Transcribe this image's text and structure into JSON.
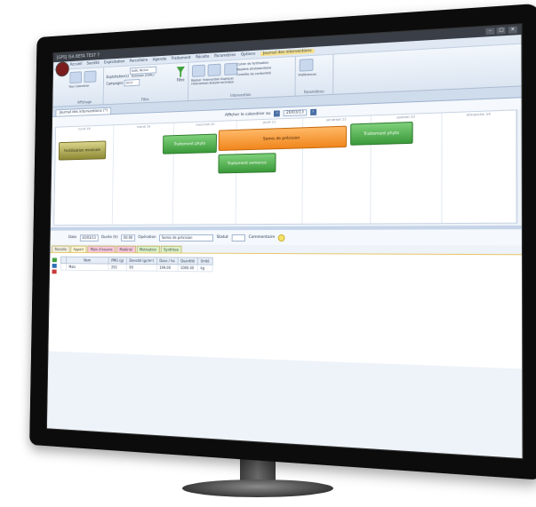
{
  "window": {
    "title": "[GPS] ISA BETA TEST 7",
    "controls": [
      "–",
      "□",
      "×"
    ]
  },
  "menu": {
    "items": [
      "Accueil",
      "Société",
      "Exploitation",
      "Parcellaire",
      "Agenda",
      "Traitement",
      "Récolte",
      "Paramètres",
      "Options"
    ],
    "active": "Journal des interventions"
  },
  "ribbon": {
    "groups": [
      {
        "label": "Affichage",
        "buttons": [
          "Tous",
          "Calendrier"
        ]
      },
      {
        "label": "Filtre",
        "exploitation_label": "Exploitation(s)",
        "exploitation_value": "EARL Michel Dubisson (EARL)",
        "campagne_label": "Campagne",
        "campagne_value": "2013",
        "filter_label": "Filtre"
      },
      {
        "label": "Intervention",
        "buttons": [
          "Réaliser l'intervention",
          "Dupliquer l'intervention",
          "Analyse technique"
        ],
        "links": [
          "Cahier de fertilisation",
          "Registre phytosanitaire",
          "Contrôle de conformité"
        ]
      },
      {
        "label": "Paramètres",
        "buttons": [
          "Préférences"
        ]
      }
    ]
  },
  "doc_tab": {
    "label": "Journal des interventions (*)"
  },
  "calendar": {
    "show_label": "Afficher le calendrier au",
    "date": "20/03/13",
    "days": [
      "lundi 18",
      "mardi 19",
      "mercredi 20",
      "jeudi 21",
      "vendredi 22",
      "samedi 23",
      "dimanche 24"
    ],
    "events": [
      {
        "label": "Fertilisation minérale",
        "color": "olive"
      },
      {
        "label": "Traitement phyto",
        "color": "green"
      },
      {
        "label": "Semis de précision",
        "color": "orange"
      },
      {
        "label": "Traitement phyto",
        "color": "green"
      },
      {
        "label": "Traitement semence",
        "color": "green"
      }
    ]
  },
  "detail": {
    "date_label": "Date",
    "date_value": "20/03/13",
    "duree_label": "Durée (h)",
    "duree_value": "00:00",
    "operation_label": "Opération",
    "operation_value": "Semis de précision",
    "statut_label": "Statut",
    "commentaire_label": "Commentaire"
  },
  "subtabs": [
    "Parcelle",
    "Apport",
    "Main d'oeuvre",
    "Matériel",
    "Motivation",
    "Synthèse"
  ],
  "grid": {
    "headers": [
      "",
      "Nom",
      "PMG (g)",
      "Densité (gr/m²)",
      "Dose / ha",
      "Quantité",
      "Unité"
    ],
    "rows": [
      [
        "",
        "Maïs",
        "292",
        "90",
        "199.00",
        "1000.40",
        "kg"
      ]
    ]
  }
}
